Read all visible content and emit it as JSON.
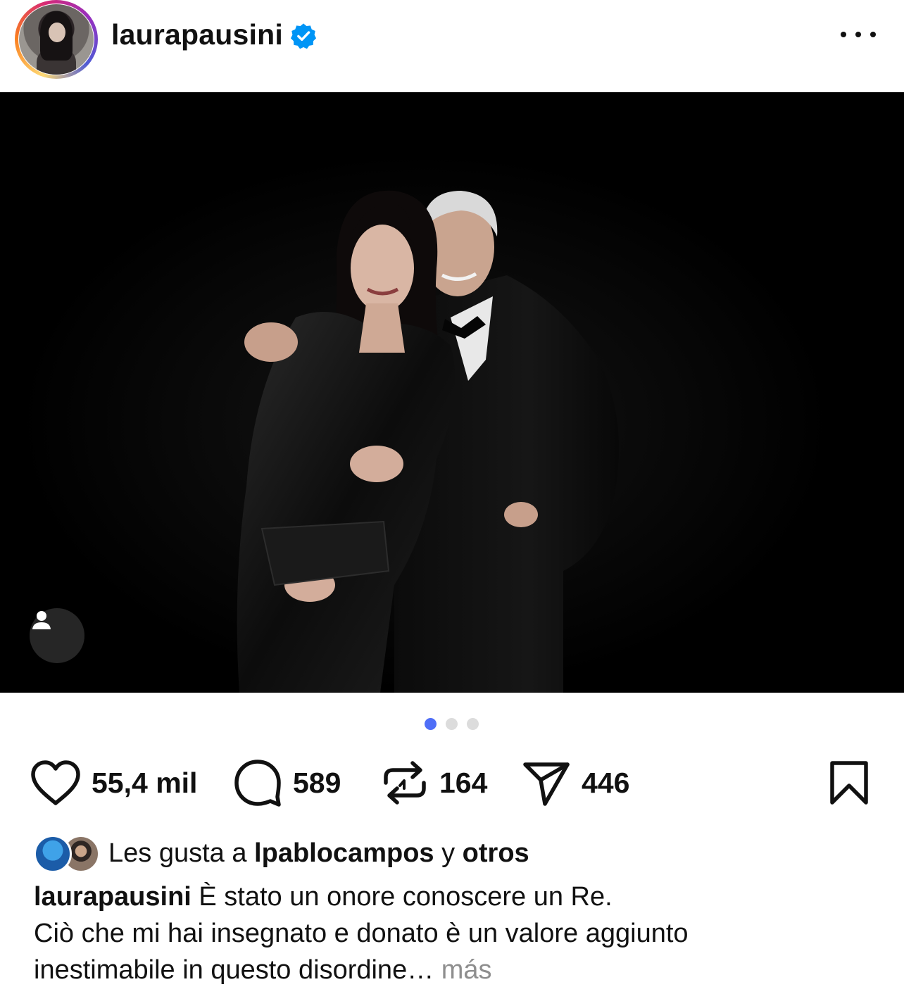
{
  "post": {
    "username": "laurapausini",
    "verified": true,
    "more_icon": "more-horizontal-icon"
  },
  "carousel": {
    "dot_count": 3,
    "active_index": 0,
    "active_color": "#4f6ef7",
    "inactive_color": "#dcdcdc"
  },
  "actions": {
    "likes": "55,4 mil",
    "comments": "589",
    "reposts": "164",
    "shares": "446"
  },
  "liked_by": {
    "prefix": "Les gusta a",
    "user": "lpablocampos",
    "joiner": "y",
    "others": "otros"
  },
  "caption": {
    "username": "laurapausini",
    "line1": "È stato un onore conoscere un Re.",
    "line2": "Ciò che mi hai insegnato e donato è un valore aggiunto",
    "line3": "inestimabile in questo disordine…",
    "more_label": "más"
  },
  "colors": {
    "verified_blue": "#0095f6",
    "text": "#111111",
    "muted": "#8e8e8e"
  }
}
